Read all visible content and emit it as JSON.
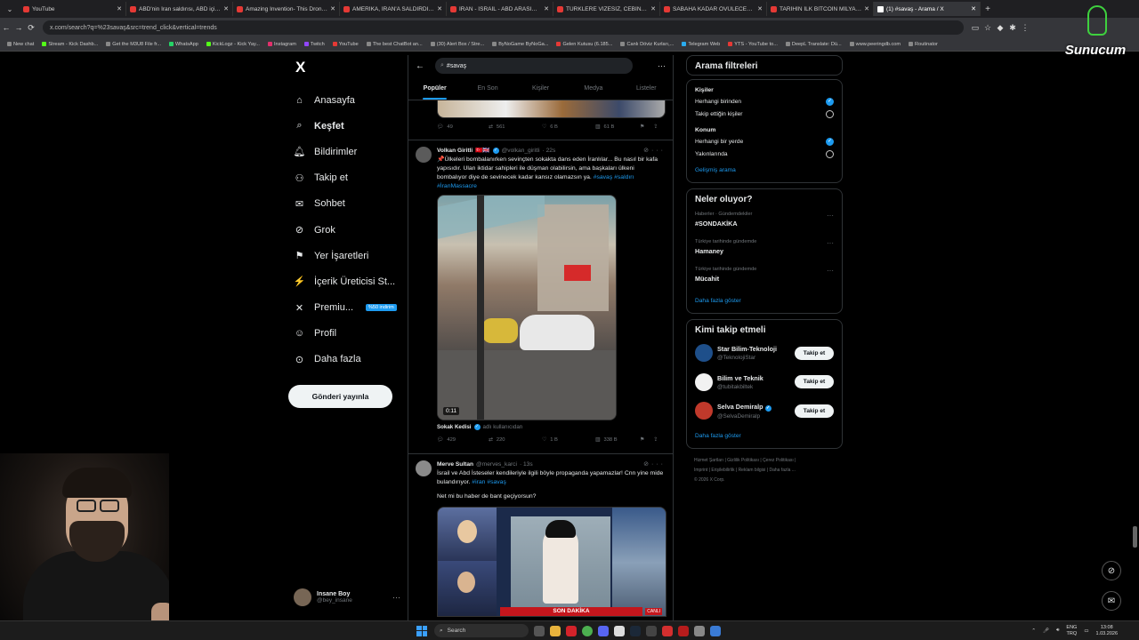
{
  "browser": {
    "tabs": [
      {
        "title": "YouTube",
        "active": false
      },
      {
        "title": "ABD'nin İran saldırısı, ABD için ç...",
        "active": false
      },
      {
        "title": "Amazing Invention- This Drone...",
        "active": false
      },
      {
        "title": "AMERİKA, İRAN'A SALDIRDI | İ...",
        "active": false
      },
      {
        "title": "İRAN - İSRAİL - ABD ARASINDA...",
        "active": false
      },
      {
        "title": "TÜRKLERE VİZESİZ, CEBİNİZİ YO...",
        "active": false
      },
      {
        "title": "SABAHA KADAR ÖVÜLECEK OY...",
        "active": false
      },
      {
        "title": "TARİHİN İLK BİTCOİN MİLYARDE...",
        "active": false
      },
      {
        "title": "(1) #savaş - Arama / X",
        "active": true
      }
    ],
    "url": "x.com/search?q=%23savaş&src=trend_click&vertical=trends",
    "bookmarks": [
      "New chat",
      "Stream - Kick Dashb...",
      "Get the M3U8 File fr...",
      "WhatsApp",
      "KickLogz - Kick Yay...",
      "Instagram",
      "Twitch",
      "YouTube",
      "The best ChatBot an...",
      "(30) Alert Box / Stre...",
      "ByNoGame ByNoGa...",
      "Gelen Kutusu (6.185...",
      "Canlı Döviz Kurları,...",
      "Telegram Web",
      "YTS - YouTube to...",
      "DeepL Translate: Dü...",
      "www.peeringdb.com",
      "Routinator"
    ]
  },
  "overlay_logo": "Sunucum",
  "nav": {
    "logo": "X",
    "items": [
      {
        "label": "Anasayfa",
        "icon": "home-icon"
      },
      {
        "label": "Keşfet",
        "icon": "search-icon"
      },
      {
        "label": "Bildirimler",
        "icon": "bell-icon"
      },
      {
        "label": "Takip et",
        "icon": "person-add-icon"
      },
      {
        "label": "Sohbet",
        "icon": "mail-icon"
      },
      {
        "label": "Grok",
        "icon": "grok-icon"
      },
      {
        "label": "Yer İşaretleri",
        "icon": "bookmark-icon"
      },
      {
        "label": "İçerik Üreticisi St...",
        "icon": "creator-studio-icon"
      },
      {
        "label": "Premiu...",
        "icon": "x-premium-icon"
      },
      {
        "label": "Profil",
        "icon": "profile-icon"
      },
      {
        "label": "Daha fazla",
        "icon": "more-circle-icon"
      }
    ],
    "premium_badge": "%50 indirim",
    "post_button": "Gönderi yayınla",
    "profile": {
      "name": "Insane Boy",
      "handle": "@bey_insane"
    }
  },
  "search": {
    "query": "#savaş",
    "tabs": [
      "Popüler",
      "En Son",
      "Kişiler",
      "Medya",
      "Listeler"
    ]
  },
  "prev_tweet_actions": {
    "replies": "49",
    "reposts": "561",
    "likes": "6 B",
    "views": "61 B"
  },
  "tweet1": {
    "name": "Volkan Giritli",
    "flags": "🇹🇷🇬🇧",
    "handle": "@volkan_giritli",
    "time": "· 22s",
    "text": "📌Ülkeleri bombalanırken sevinçten sokakta dans eden İranlılar... Bu nasıl bir kafa yapısıdır. Ulan iktidar sahipleri ile düşman olabilirsin, ama başkaları ülkeni bombalıyor diye de sevinecek kadar kansız olamazsın ya.",
    "tags": [
      "#savaş",
      "#saldırı",
      "#İranMassacre"
    ],
    "video_duration": "0:11",
    "source_name": "Sokak Kedisi",
    "source_handle": "adlı kullanıcıdan",
    "replies": "429",
    "reposts": "220",
    "likes": "1 B",
    "views": "338 B"
  },
  "tweet2": {
    "name": "Merve Sultan",
    "handle": "@merves_karci",
    "time": "· 13s",
    "text": "İsrail ve Abd İsteseler kendileriyle ilgili böyle propaganda yapamazlar! Cnn yine mide bulandırıyor.",
    "tags": [
      "#iran",
      "#savaş"
    ],
    "subtext": "Net mi bu haber de bant geçiyorsun?",
    "banner": "SON DAKİKA",
    "live": "CANLI"
  },
  "filters": {
    "title": "Arama filtreleri",
    "people_label": "Kişiler",
    "people_opts": [
      "Herhangi birinden",
      "Takip ettiğin kişiler"
    ],
    "people_selected": 0,
    "location_label": "Konum",
    "location_opts": [
      "Herhangi bir yerde",
      "Yakınlarında"
    ],
    "location_selected": 0,
    "advanced": "Gelişmiş arama"
  },
  "trends": {
    "title": "Neler oluyor?",
    "items": [
      {
        "context": "Haberler · Gündemdekiler",
        "name": "#SONDAKİKA"
      },
      {
        "context": "Türkiye tarihinde gündemde",
        "name": "Hamaney"
      },
      {
        "context": "Türkiye tarihinde gündemde",
        "name": "Mücahit"
      }
    ],
    "more": "Daha fazla göster"
  },
  "who_to_follow": {
    "title": "Kimi takip etmeli",
    "items": [
      {
        "name": "Star Bilim-Teknoloji",
        "handle": "@TeknolojiStar",
        "verified": false,
        "button": "Takip et",
        "color": "#1e4f8a"
      },
      {
        "name": "Bilim ve Teknik",
        "handle": "@tubitakbiltek",
        "verified": false,
        "button": "Takip et",
        "color": "#f2f2f2"
      },
      {
        "name": "Selva Demiralp",
        "handle": "@SelvaDemiralp",
        "verified": true,
        "button": "Takip et",
        "color": "#c0392b"
      }
    ],
    "more": "Daha fazla göster"
  },
  "footer": [
    "Hizmet Şartları",
    "Gizlilik Politikası",
    "Çerez Politikası",
    "Imprint",
    "Erişilebilirlik",
    "Reklam bilgisi",
    "Daha fazla ...",
    "© 2026 X Corp."
  ],
  "taskbar": {
    "search_placeholder": "Search",
    "lang": "ENG",
    "lang2": "TRQ",
    "time": "13:08",
    "date": "1.03.2026"
  },
  "colors": {
    "accent": "#1d9bf0",
    "bg": "#000000",
    "border": "#2f3336",
    "muted": "#71767b"
  }
}
